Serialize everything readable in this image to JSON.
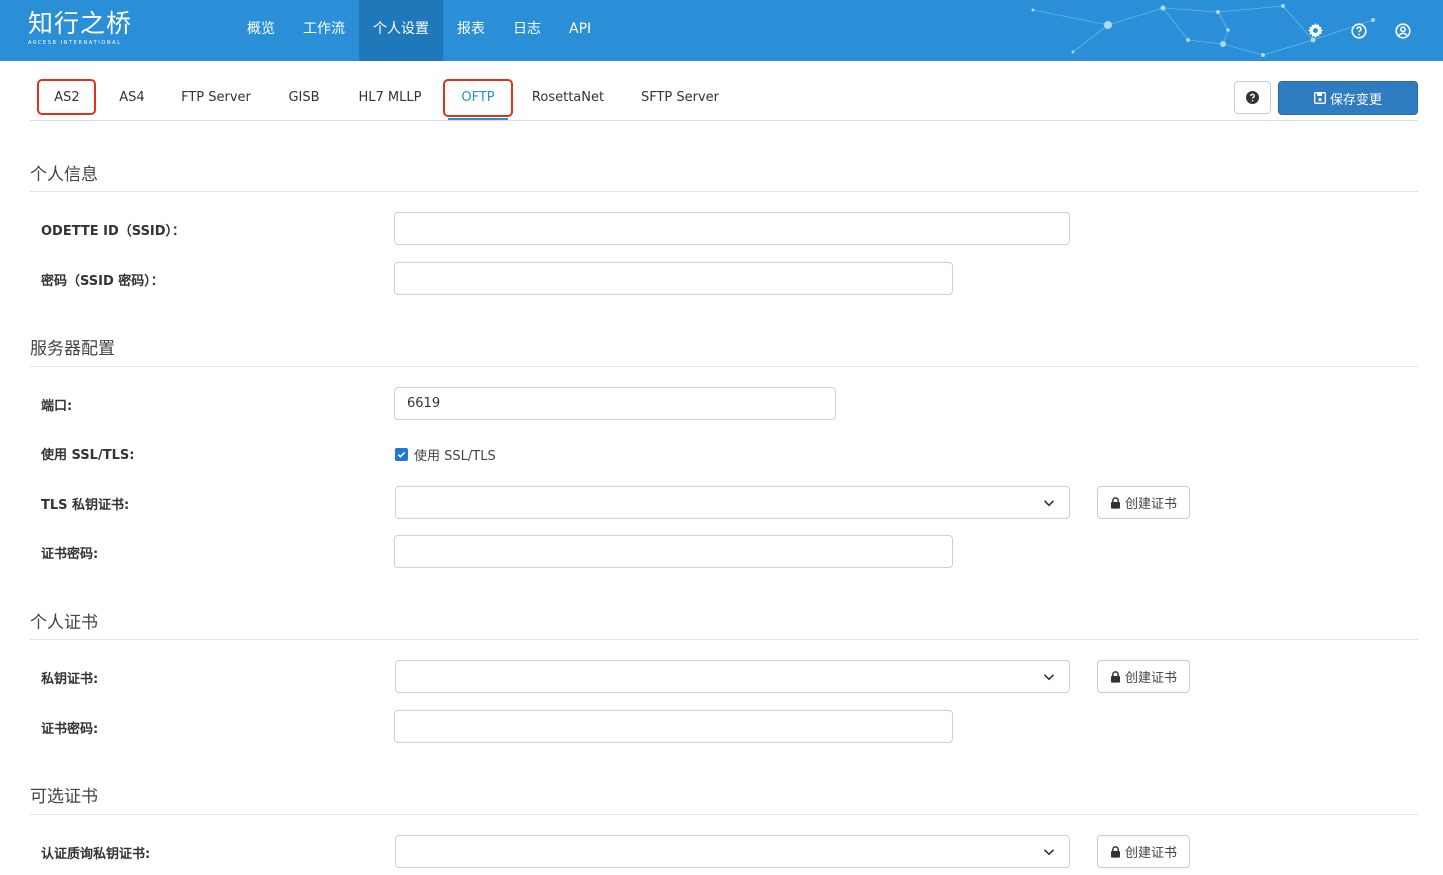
{
  "brand": {
    "logo_text": "知行之桥",
    "logo_subtext": "ARCESB INTERNATIONAL",
    "color": "#2a8fd6"
  },
  "nav": {
    "items": [
      {
        "label": "概览"
      },
      {
        "label": "工作流"
      },
      {
        "label": "个人设置",
        "active": true
      },
      {
        "label": "报表"
      },
      {
        "label": "日志"
      },
      {
        "label": "API"
      }
    ],
    "icons": [
      "gear-icon",
      "question-circle-icon",
      "user-circle-icon"
    ]
  },
  "tabs": {
    "items": [
      {
        "label": "AS2",
        "highlighted": true
      },
      {
        "label": "AS4"
      },
      {
        "label": "FTP Server"
      },
      {
        "label": "GISB"
      },
      {
        "label": "HL7 MLLP"
      },
      {
        "label": "OFTP",
        "active": true,
        "highlighted": true
      },
      {
        "label": "RosettaNet"
      },
      {
        "label": "SFTP Server"
      }
    ],
    "highlight_color": "#e0311f"
  },
  "toolbar": {
    "help_icon": "question-icon",
    "save_label": "保存变更",
    "save_icon": "floppy-disk-icon"
  },
  "sections": {
    "personal_info": {
      "title": "个人信息",
      "odette_id_label": "ODETTE ID（SSID）：",
      "odette_id_value": "",
      "password_label": "密码（SSID 密码）：",
      "password_value": ""
    },
    "server_config": {
      "title": "服务器配置",
      "port_label": "端口:",
      "port_value": "6619",
      "ssl_label": "使用 SSL/TLS:",
      "ssl_checkbox_label": "使用 SSL/TLS",
      "ssl_checked": true,
      "tls_cert_label": "TLS 私钥证书:",
      "tls_cert_value": "",
      "create_cert_label": "创建证书",
      "cert_password_label": "证书密码:",
      "cert_password_value": ""
    },
    "personal_cert": {
      "title": "个人证书",
      "private_cert_label": "私钥证书:",
      "private_cert_value": "",
      "create_cert_label": "创建证书",
      "cert_password_label": "证书密码:",
      "cert_password_value": ""
    },
    "optional_cert": {
      "title": "可选证书",
      "auth_cert_label": "认证质询私钥证书:",
      "auth_cert_value": "",
      "create_cert_label": "创建证书"
    }
  }
}
